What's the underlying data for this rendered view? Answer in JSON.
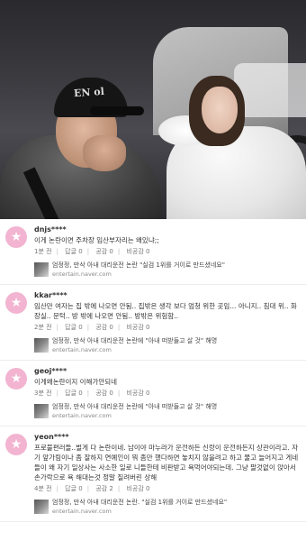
{
  "photo": {
    "cap_text": "EN ol"
  },
  "comments": [
    {
      "user": "dnjs****",
      "text": "이게 논란이면 주차장 임산부자리는 왜있냐;;",
      "time": "1분 전",
      "reply": "답글 0",
      "like": "공감 0",
      "dislike": "비공감 0",
      "source_title": "엄정정, 만삭 아내 대리운전 논란 \"실검 1위를 거이로 만드셨네요\"",
      "source_domain": "entertain.naver.com",
      "icon": "star-icon"
    },
    {
      "user": "kkar****",
      "text": "임산만 여자는 집 밖에 나오면 안됨.. 집밖은 생각 보다 엄청 위한 곳임... 아니지.. 침대 위.. 화장실.. 문턱.. 방 밖에 나오면 안됨.. 방밖은 위험함..",
      "time": "2분 전",
      "reply": "답글 0",
      "like": "공감 0",
      "dislike": "비공감 0",
      "source_title": "엄정정, 만삭 아내 대리운전 논란에 \"아내 떠받들고 살 것\" 해명",
      "source_domain": "entertain.naver.com",
      "icon": "star-icon"
    },
    {
      "user": "geoj****",
      "text": "이게왜논란이지 이해가안되네",
      "time": "3분 전",
      "reply": "답글 0",
      "like": "공감 0",
      "dislike": "비공감 0",
      "source_title": "엄정정, 만삭 아내 대리운전 논란에 \"아내 떠받들고 살 것\" 해명",
      "source_domain": "entertain.naver.com",
      "icon": "star-icon"
    },
    {
      "user": "yeon****",
      "text": "프로불편러들..벌게 다 논란이네. 남이야 마누라가 운전하든 신랑이 운전하든지 상관이라고. 자기 앞가림이나 좀 잘하지 연예인이 뭐 좀만 했다하면 놓치지 않을려고 하고 물고 늘어지고 게네들이 왜 자기 일상사는 사소한 일로 니들한테 비판받고 욕먹어야되는데. 그냥 팔것없이 앉아서 손가락으로 욕 해대는것 정말 질려버린 상해",
      "time": "4분 전",
      "reply": "답글 0",
      "like": "공감 2",
      "dislike": "비공감 0",
      "source_title": "엄정정, 만삭 아내 대리운전 논란. \"실검 1위를 거이로 만드셨네요\"",
      "source_domain": "entertain.naver.com",
      "icon": "star-icon"
    }
  ]
}
